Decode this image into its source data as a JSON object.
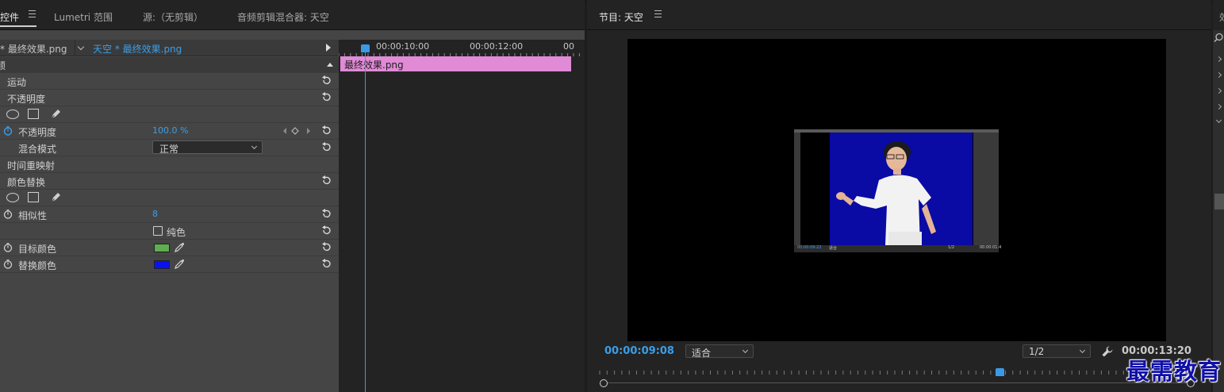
{
  "left_panel": {
    "tabs": [
      {
        "label": "控件"
      },
      {
        "label": "Lumetri 范围"
      },
      {
        "label": "源:（无剪辑）"
      },
      {
        "label": "音频剪辑混合器: 天空"
      }
    ],
    "clip_source": "* 最终效果.png",
    "clip_sequence": "天空 * 最终效果.png",
    "header_fragment": "颉",
    "properties": {
      "motion": "运动",
      "opacity_group": "不透明度",
      "opacity": "不透明度",
      "opacity_value": "100.0 %",
      "blend_mode": "混合模式",
      "blend_value": "正常",
      "time_remap": "时间重映射",
      "color_replace": "颜色替换",
      "similarity": "相似性",
      "similarity_value": "8",
      "solid_colors": "纯色",
      "target_color": "目标颜色",
      "replace_color": "替换颜色"
    },
    "colors": {
      "target": "#5fae4f",
      "replace": "#0a12f0"
    },
    "timeline": {
      "tc_1": "00:00:10:00",
      "tc_2": "00:00:12:00",
      "tc_3": "00",
      "clip_name": "最终效果.png"
    }
  },
  "program_monitor": {
    "title": "节目: 天空",
    "current_time": "00:00:09:08",
    "fit_label": "适合",
    "resolution": "1/2",
    "end_time": "00:00:13:20",
    "nested": {
      "time": "00:00:09:22",
      "fit": "适合",
      "res": "1/2",
      "end": "00:00:01:4"
    }
  },
  "effects_panel": {
    "tab_fragment": "效"
  },
  "watermark": "最需教育"
}
